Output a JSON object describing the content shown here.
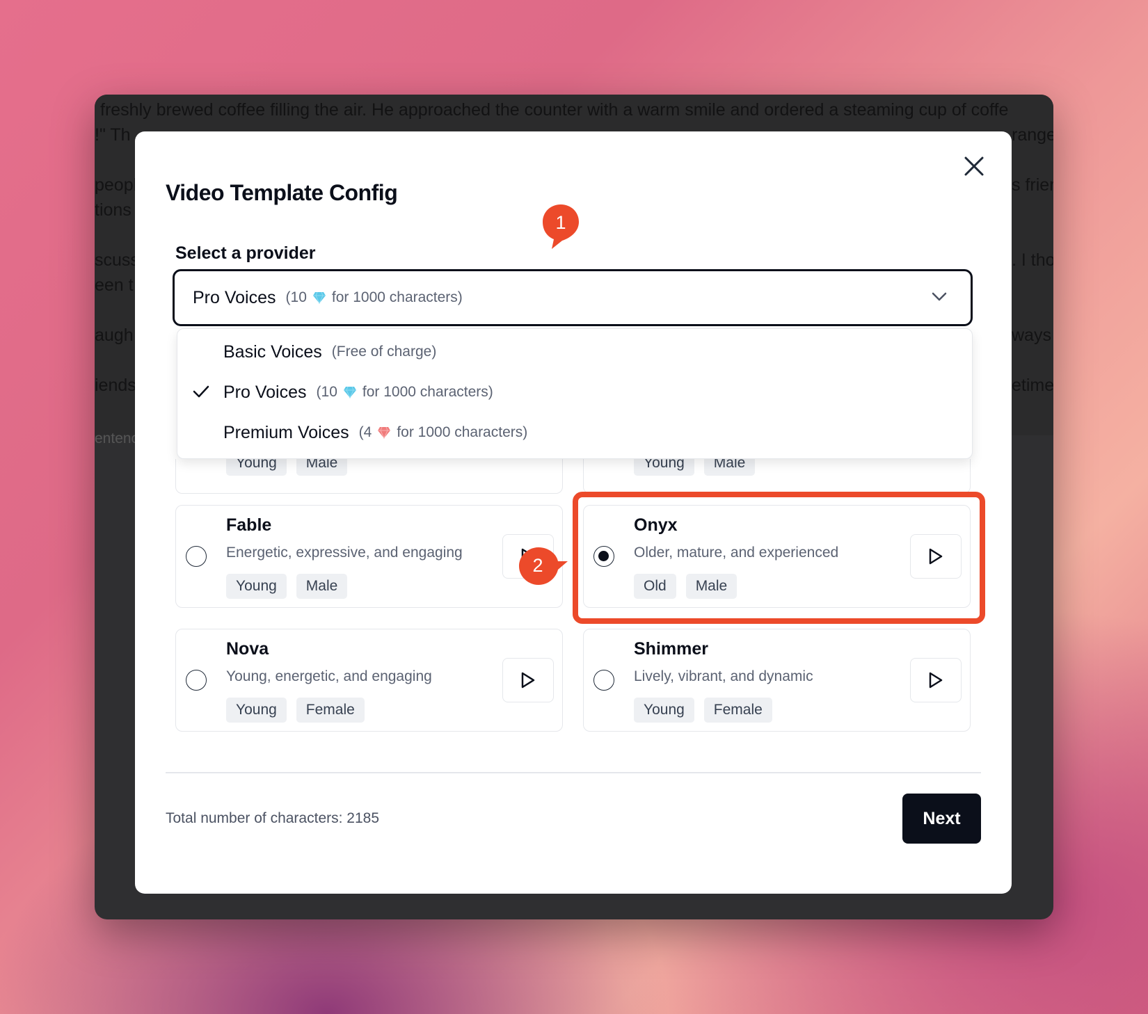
{
  "background_editor": {
    "lines": [
      "freshly brewed coffee filling the air. He approached the counter with a warm smile and ordered a steaming cup of coffe",
      "!\" Th",
      "peopl",
      "tions",
      "scuss",
      "een t",
      "augh",
      "iends"
    ],
    "right_fragments": [
      "range",
      "s frier",
      ". I tho",
      "ways",
      "etimes"
    ],
    "footnote": "entenc"
  },
  "modal": {
    "title": "Video Template Config",
    "provider_label": "Select a provider",
    "selected_provider": {
      "name": "Pro Voices",
      "price_prefix": "(10",
      "price_suffix": "for 1000 characters)"
    },
    "provider_options": [
      {
        "name": "Basic Voices",
        "price": "(Free of charge)",
        "selected": false
      },
      {
        "name": "Pro Voices",
        "price_prefix": "(10",
        "price_suffix": "for 1000 characters)",
        "gem": "blue-diamond-icon",
        "selected": true
      },
      {
        "name": "Premium Voices",
        "price_prefix": "(4",
        "price_suffix": "for 1000 characters)",
        "gem": "red-gem-icon",
        "selected": false
      }
    ],
    "partial_cards": [
      {
        "tags": [
          "Young",
          "Male"
        ]
      },
      {
        "tags": [
          "Young",
          "Male"
        ]
      }
    ],
    "voices": [
      {
        "name": "Fable",
        "description": "Energetic, expressive, and engaging",
        "tags": [
          "Young",
          "Male"
        ],
        "selected": false
      },
      {
        "name": "Onyx",
        "description": "Older, mature, and experienced",
        "tags": [
          "Old",
          "Male"
        ],
        "selected": true
      },
      {
        "name": "Nova",
        "description": "Young, energetic, and engaging",
        "tags": [
          "Young",
          "Female"
        ],
        "selected": false
      },
      {
        "name": "Shimmer",
        "description": "Lively, vibrant, and dynamic",
        "tags": [
          "Young",
          "Female"
        ],
        "selected": false
      }
    ],
    "char_count": "Total number of characters: 2185",
    "next_label": "Next"
  },
  "annotations": {
    "callout_1": "1",
    "callout_2": "2",
    "accent_color": "#ec4a2a"
  },
  "colors": {
    "primary": "#0b0f1a",
    "muted_text": "#5b6272",
    "tag_bg": "#eef0f3",
    "blue_gem": "#5bc8e8",
    "red_gem": "#f07b7b"
  }
}
